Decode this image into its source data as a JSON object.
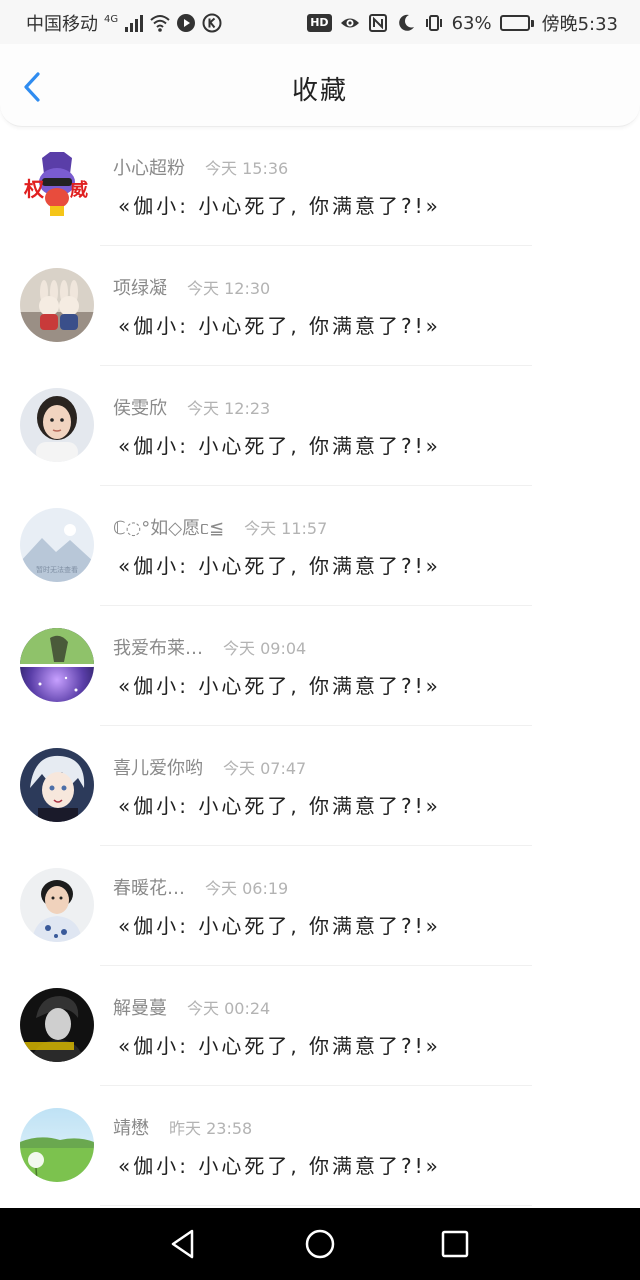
{
  "status_bar": {
    "carrier": "中国移动",
    "network": "4G",
    "battery_percent": "63%",
    "battery_level": 0.63,
    "time": "傍晚5:33",
    "hd_label": "HD"
  },
  "header": {
    "title": "收藏",
    "accent_color": "#2f8cf0"
  },
  "favorites": [
    {
      "name": "小心超粉",
      "time": "今天 15:36",
      "text": "«伽小: 小心死了, 你满意了?!»",
      "avatar_icon": "cartoon-avatar"
    },
    {
      "name": "项绿凝",
      "time": "今天 12:30",
      "text": "«伽小: 小心死了, 你满意了?!»",
      "avatar_icon": "toy-rabbits-avatar"
    },
    {
      "name": "侯雯欣",
      "time": "今天 12:23",
      "text": "«伽小: 小心死了, 你满意了?!»",
      "avatar_icon": "girl-photo-avatar"
    },
    {
      "name": "ℂ◌°如◇愿ᥴ≦",
      "time": "今天 11:57",
      "text": "«伽小: 小心死了, 你满意了?!»",
      "avatar_icon": "placeholder-mountain-avatar",
      "avatar_caption": "暂时无法查看"
    },
    {
      "name": "我爱布莱…",
      "time": "今天 09:04",
      "text": "«伽小: 小心死了, 你满意了?!»",
      "avatar_icon": "galaxy-avatar"
    },
    {
      "name": "喜儿爱你哟",
      "time": "今天 07:47",
      "text": "«伽小: 小心死了, 你满意了?!»",
      "avatar_icon": "anime-avatar"
    },
    {
      "name": "春暖花…",
      "time": "今天 06:19",
      "text": "«伽小: 小心死了, 你满意了?!»",
      "avatar_icon": "woman-photo-avatar"
    },
    {
      "name": "解曼蔓",
      "time": "今天 00:24",
      "text": "«伽小: 小心死了, 你满意了?!»",
      "avatar_icon": "monochrome-portrait-avatar"
    },
    {
      "name": "靖懋",
      "time": "昨天 23:58",
      "text": "«伽小: 小心死了, 你满意了?!»",
      "avatar_icon": "landscape-dandelion-avatar"
    }
  ]
}
